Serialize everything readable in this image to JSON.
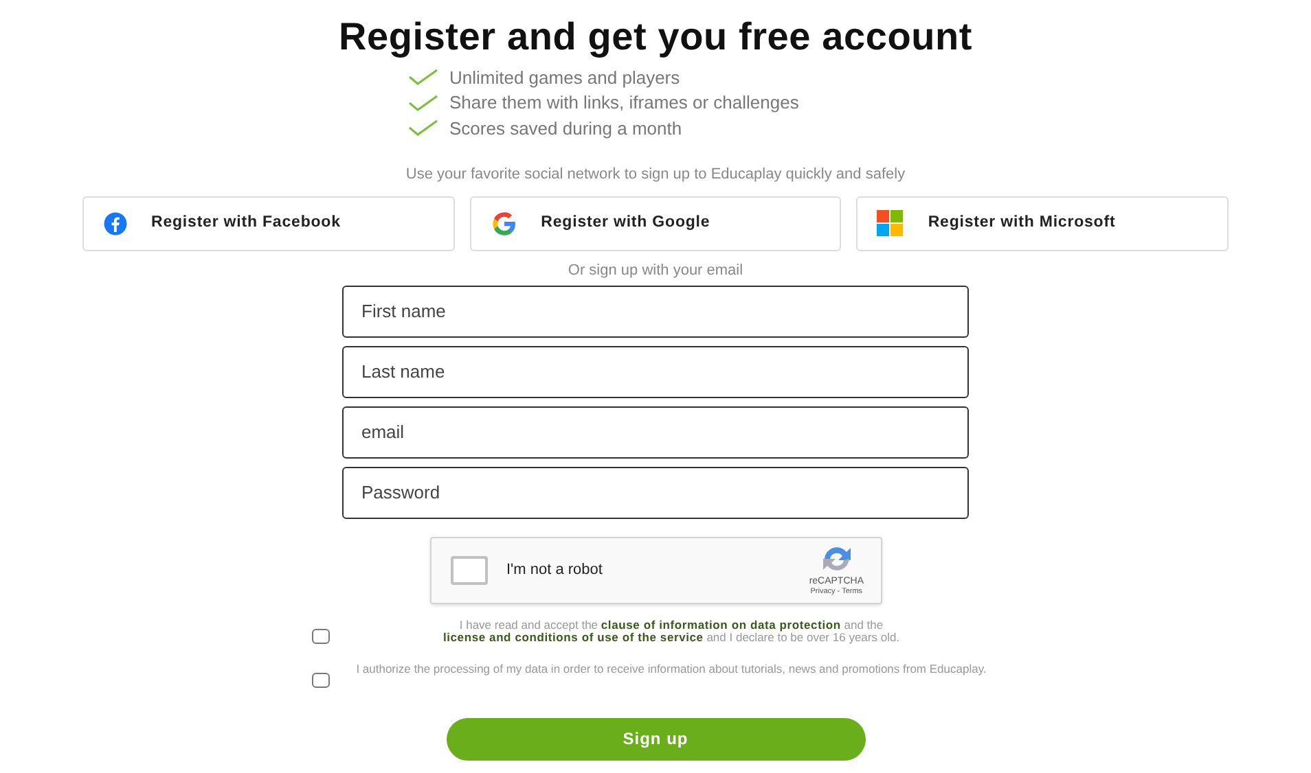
{
  "title": "Register and get you free account",
  "benefits": [
    "Unlimited games and players",
    "Share them with links, iframes or challenges",
    "Scores saved during a month"
  ],
  "social_intro": "Use your favorite social network to sign up to Educaplay quickly and safely",
  "social_buttons": [
    {
      "kind": "facebook",
      "label": "Register with Facebook"
    },
    {
      "kind": "google",
      "label": "Register with Google"
    },
    {
      "kind": "microsoft",
      "label": "Register with Microsoft"
    }
  ],
  "email_intro": "Or sign up with your email",
  "fields": [
    {
      "placeholder": "First name"
    },
    {
      "placeholder": "Last name"
    },
    {
      "placeholder": "email"
    },
    {
      "placeholder": "Password"
    }
  ],
  "captcha": {
    "label": "I'm not a robot",
    "checked": false,
    "brand": "reCAPTCHA",
    "links": "Privacy - Terms"
  },
  "consents": [
    {
      "checked": false,
      "parts": [
        {
          "kind": "text",
          "text": "I have read and accept the "
        },
        {
          "kind": "link",
          "text": "clause of information on data protection"
        },
        {
          "kind": "text",
          "text": " and the "
        },
        {
          "kind": "link",
          "text": "license and conditions of use of the service"
        },
        {
          "kind": "text",
          "text": " and I declare to be over 16 years old."
        }
      ]
    },
    {
      "checked": false,
      "parts": [
        {
          "kind": "text",
          "text": "I authorize the processing of my data in order to receive information about tutorials, news and promotions from Educaplay."
        }
      ]
    }
  ],
  "submit": "Sign up"
}
